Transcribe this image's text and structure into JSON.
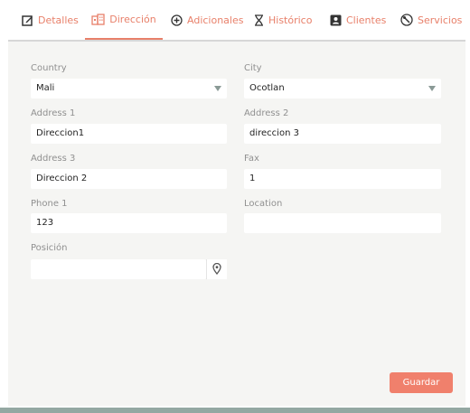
{
  "tabs": [
    {
      "label": "Detalles",
      "icon": "edit-icon"
    },
    {
      "label": "Dirección",
      "icon": "building-icon",
      "active": true
    },
    {
      "label": "Adicionales",
      "icon": "plus-circle-icon"
    },
    {
      "label": "Histórico",
      "icon": "hourglass-icon"
    },
    {
      "label": "Clientes",
      "icon": "contact-card-icon"
    },
    {
      "label": "Servicios",
      "icon": "services-icon"
    }
  ],
  "form": {
    "country": {
      "label": "Country",
      "value": "Mali"
    },
    "city": {
      "label": "City",
      "value": "Ocotlan"
    },
    "address1": {
      "label": "Address 1",
      "value": "Direccion1"
    },
    "address2": {
      "label": "Address 2",
      "value": "direccion 3"
    },
    "address3": {
      "label": "Address 3",
      "value": "Direccion 2"
    },
    "fax": {
      "label": "Fax",
      "value": "1"
    },
    "phone1": {
      "label": "Phone 1",
      "value": "123"
    },
    "location": {
      "label": "Location",
      "value": ""
    },
    "posicion": {
      "label": "Posición",
      "value": "",
      "icon": "map-pin-icon"
    }
  },
  "actions": {
    "save_label": "Guardar"
  },
  "colors": {
    "accent": "#f0806c",
    "tab_text": "#e8806a",
    "panel_bg": "#f5f5f3",
    "bottom_bar": "#94a8a2"
  }
}
